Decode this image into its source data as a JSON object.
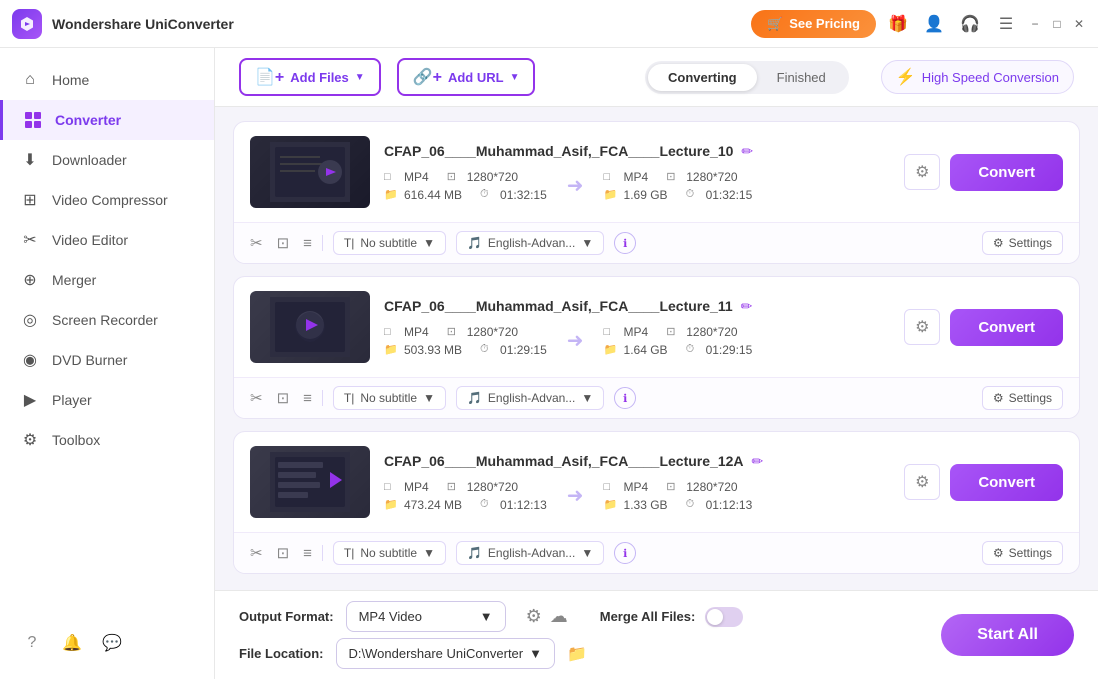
{
  "app": {
    "logo_alt": "Wondershare UniConverter",
    "title": "Wondershare UniConverter"
  },
  "titlebar": {
    "see_pricing": "See Pricing",
    "gift_icon": "🎁",
    "minimize": "−",
    "maximize": "□",
    "close": "✕"
  },
  "sidebar": {
    "items": [
      {
        "id": "home",
        "label": "Home",
        "icon": "⌂"
      },
      {
        "id": "converter",
        "label": "Converter",
        "icon": "▣",
        "active": true
      },
      {
        "id": "downloader",
        "label": "Downloader",
        "icon": "⬇"
      },
      {
        "id": "video-compressor",
        "label": "Video Compressor",
        "icon": "⊞"
      },
      {
        "id": "video-editor",
        "label": "Video Editor",
        "icon": "✂"
      },
      {
        "id": "merger",
        "label": "Merger",
        "icon": "⊕"
      },
      {
        "id": "screen-recorder",
        "label": "Screen Recorder",
        "icon": "◎"
      },
      {
        "id": "dvd-burner",
        "label": "DVD Burner",
        "icon": "◉"
      },
      {
        "id": "player",
        "label": "Player",
        "icon": "▶"
      },
      {
        "id": "toolbox",
        "label": "Toolbox",
        "icon": "⚙"
      }
    ],
    "bottom_icons": [
      "?",
      "🔔",
      "◎"
    ]
  },
  "toolbar": {
    "add_files_label": "Add Files",
    "add_url_label": "Add URL",
    "tab_converting": "Converting",
    "tab_finished": "Finished",
    "high_speed_label": "High Speed Conversion"
  },
  "files": [
    {
      "id": 1,
      "name": "CFAP_06____Muhammad_Asif,_FCA____Lecture_10",
      "src_format": "MP4",
      "src_resolution": "1280*720",
      "src_size": "616.44 MB",
      "src_duration": "01:32:15",
      "dst_format": "MP4",
      "dst_resolution": "1280*720",
      "dst_size": "1.69 GB",
      "dst_duration": "01:32:15",
      "subtitle": "No subtitle",
      "audio": "English-Advan...",
      "convert_label": "Convert",
      "settings_label": "Settings"
    },
    {
      "id": 2,
      "name": "CFAP_06____Muhammad_Asif,_FCA____Lecture_11",
      "src_format": "MP4",
      "src_resolution": "1280*720",
      "src_size": "503.93 MB",
      "src_duration": "01:29:15",
      "dst_format": "MP4",
      "dst_resolution": "1280*720",
      "dst_size": "1.64 GB",
      "dst_duration": "01:29:15",
      "subtitle": "No subtitle",
      "audio": "English-Advan...",
      "convert_label": "Convert",
      "settings_label": "Settings"
    },
    {
      "id": 3,
      "name": "CFAP_06____Muhammad_Asif,_FCA____Lecture_12A",
      "src_format": "MP4",
      "src_resolution": "1280*720",
      "src_size": "473.24 MB",
      "src_duration": "01:12:13",
      "dst_format": "MP4",
      "dst_resolution": "1280*720",
      "dst_size": "1.33 GB",
      "dst_duration": "01:12:13",
      "subtitle": "No subtitle",
      "audio": "English-Advan...",
      "convert_label": "Convert",
      "settings_label": "Settings"
    }
  ],
  "bottom": {
    "output_format_label": "Output Format:",
    "output_format_value": "MP4 Video",
    "merge_label": "Merge All Files:",
    "file_location_label": "File Location:",
    "file_location_value": "D:\\Wondershare UniConverter",
    "start_all_label": "Start All"
  },
  "colors": {
    "accent": "#9333ea",
    "accent_light": "#a855f7",
    "bg": "#f5f4fa"
  }
}
